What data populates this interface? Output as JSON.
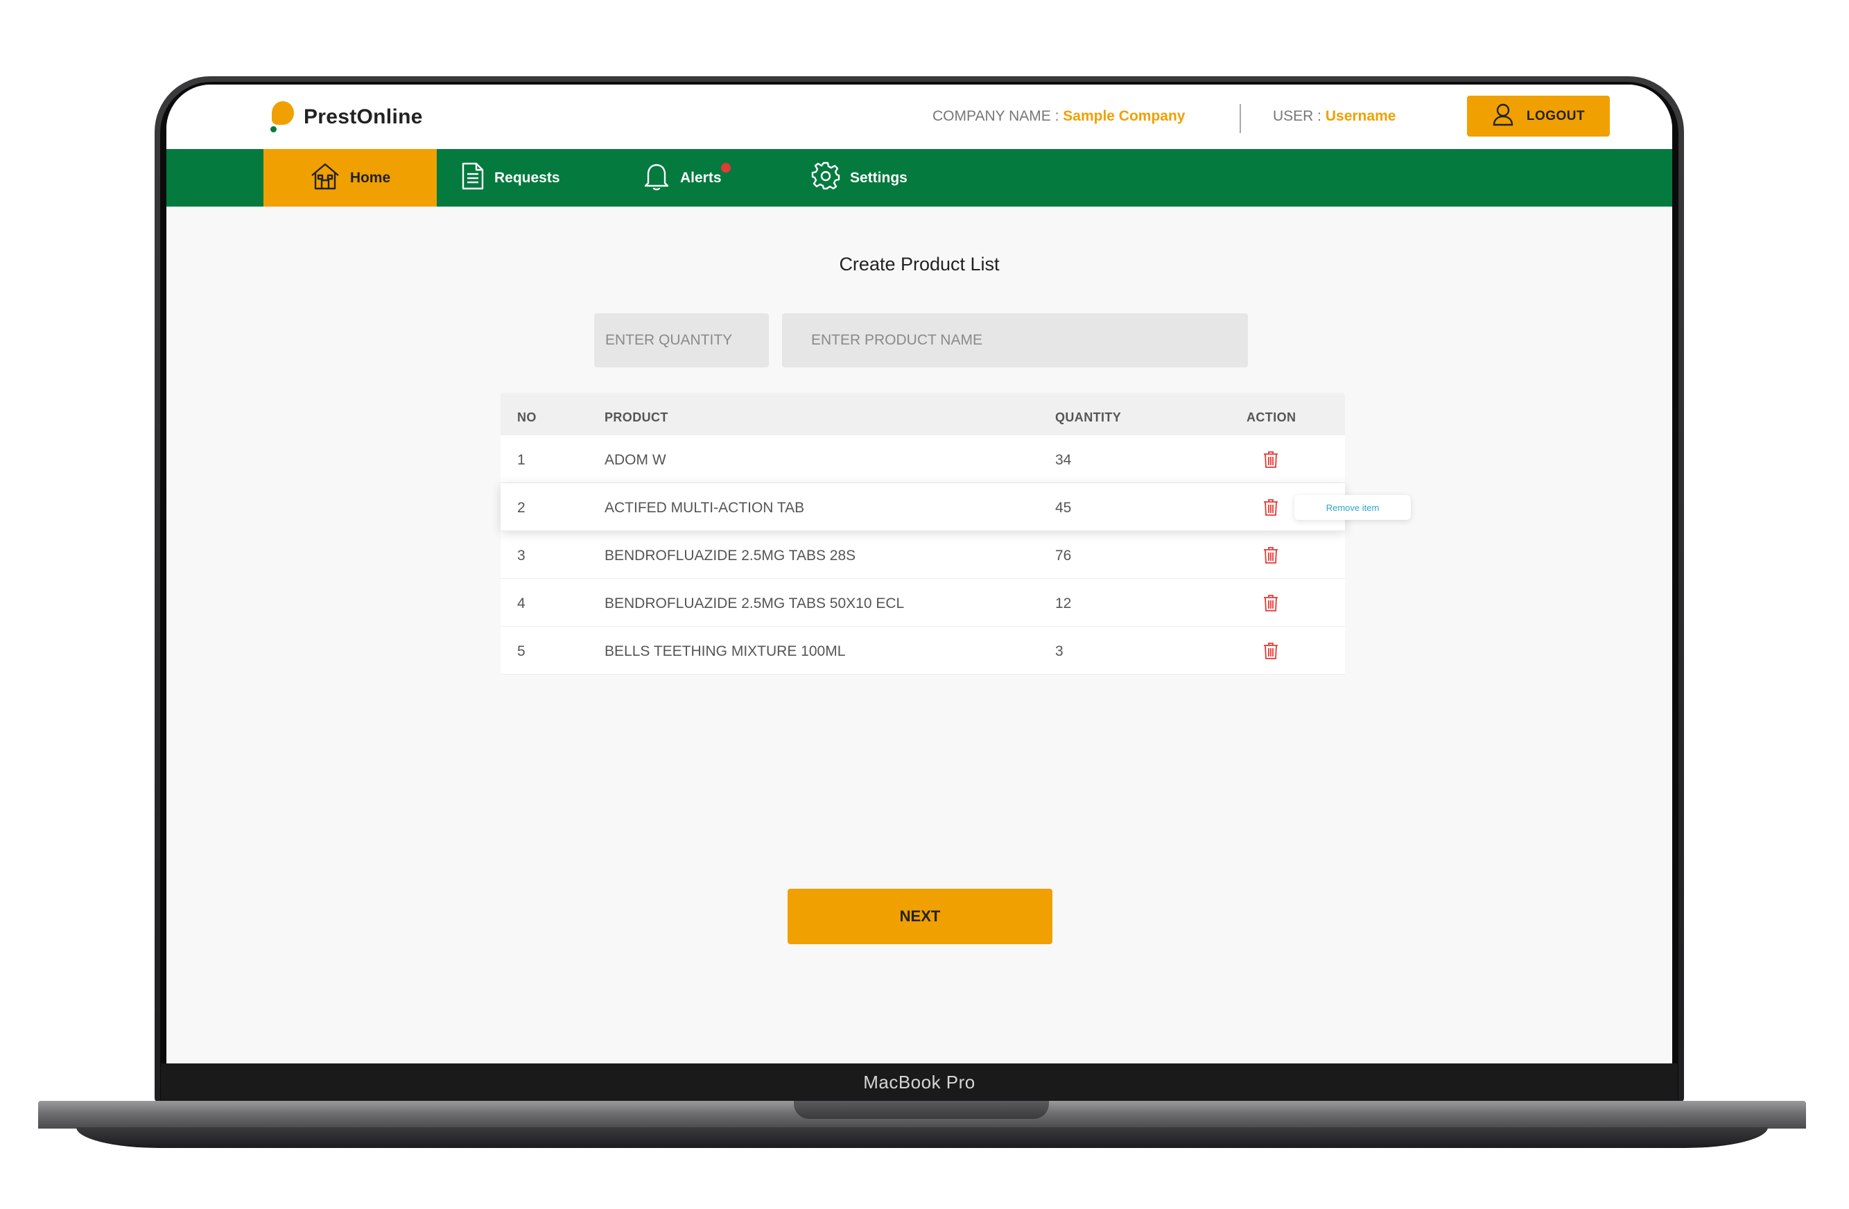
{
  "device": {
    "label": "MacBook Pro"
  },
  "header": {
    "brand": "PrestOnline",
    "company_label": "COMPANY NAME : ",
    "company_value": "Sample Company",
    "user_label": "USER : ",
    "user_value": "Username",
    "logout_label": "LOGOUT"
  },
  "nav": {
    "items": [
      {
        "label": "Home",
        "icon": "home-icon",
        "active": true
      },
      {
        "label": "Requests",
        "icon": "document-icon",
        "active": false
      },
      {
        "label": "Alerts",
        "icon": "bell-icon",
        "active": false,
        "has_notification": true
      },
      {
        "label": "Settings",
        "icon": "gear-icon",
        "active": false
      }
    ]
  },
  "main": {
    "title": "Create Product List",
    "quantity_placeholder": "ENTER QUANTITY",
    "product_placeholder": "ENTER PRODUCT NAME",
    "table": {
      "headers": [
        "NO",
        "PRODUCT",
        "QUANTITY",
        "ACTION"
      ],
      "rows": [
        {
          "no": "1",
          "product": "ADOM W",
          "quantity": "34"
        },
        {
          "no": "2",
          "product": "ACTIFED MULTI-ACTION TAB",
          "quantity": "45"
        },
        {
          "no": "3",
          "product": "BENDROFLUAZIDE 2.5MG TABS 28S",
          "quantity": "76"
        },
        {
          "no": "4",
          "product": "BENDROFLUAZIDE 2.5MG TABS 50X10 ECL",
          "quantity": "12"
        },
        {
          "no": "5",
          "product": "BELLS TEETHING MIXTURE 100ML",
          "quantity": "3"
        }
      ],
      "tooltip": "Remove item"
    },
    "next_label": "NEXT"
  },
  "colors": {
    "accent": "#f0a000",
    "nav": "#047a3e",
    "danger": "#e53935"
  }
}
